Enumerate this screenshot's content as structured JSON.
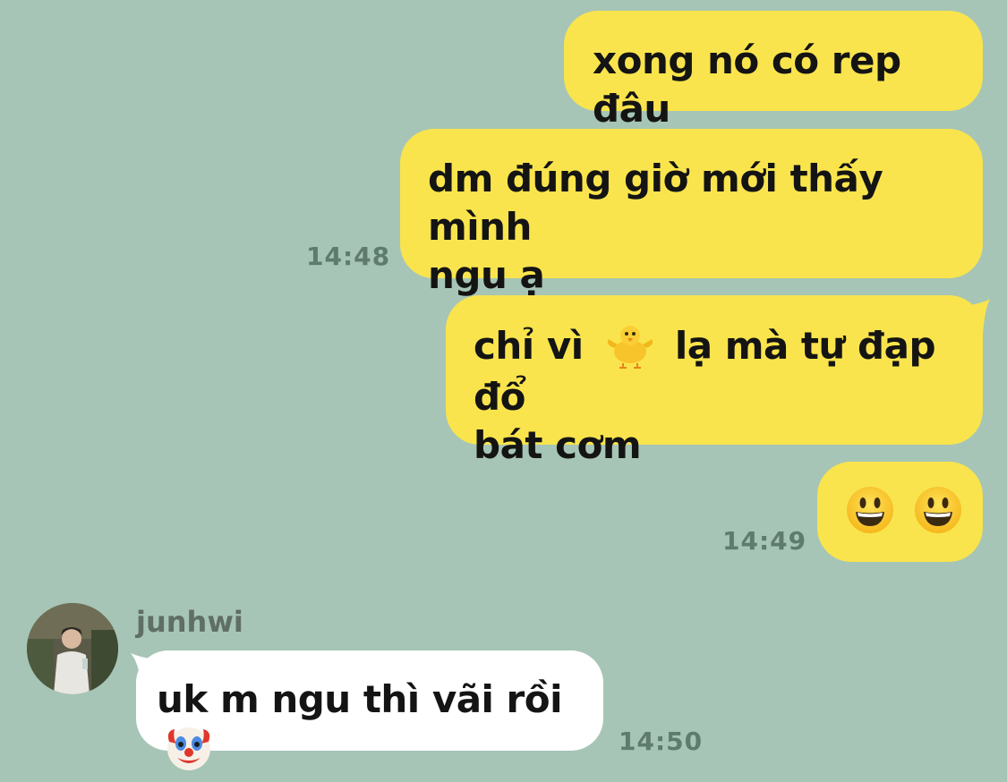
{
  "messages": [
    {
      "id": "m1",
      "direction": "outgoing",
      "lines": [
        "xong nó có rep đâu"
      ]
    },
    {
      "id": "m2",
      "direction": "outgoing",
      "lines": [
        "dm đúng giờ mới thấy mình",
        "ngu ạ"
      ],
      "time": "14:48"
    },
    {
      "id": "m3",
      "direction": "outgoing",
      "line1_before_emoji": "chỉ vì",
      "line1_emoji": "chick-emoji",
      "line1_after_emoji": "lạ mà tự đạp đổ",
      "line2": "bát cơm"
    },
    {
      "id": "m4",
      "direction": "outgoing",
      "emojis": [
        "grinning-face-emoji",
        "grinning-face-emoji"
      ],
      "time": "14:49"
    },
    {
      "id": "m5",
      "direction": "incoming",
      "sender": "junhwi",
      "text": "uk m ngu thì vãi rồi",
      "emoji": "clown-face-emoji",
      "time": "14:50"
    }
  ],
  "colors": {
    "background": "#a6c5b6",
    "outgoing_bubble": "#f9e44d",
    "incoming_bubble": "#ffffff",
    "timestamp": "#5f7a6e"
  },
  "icons": {
    "avatar": "user-avatar-photo"
  }
}
